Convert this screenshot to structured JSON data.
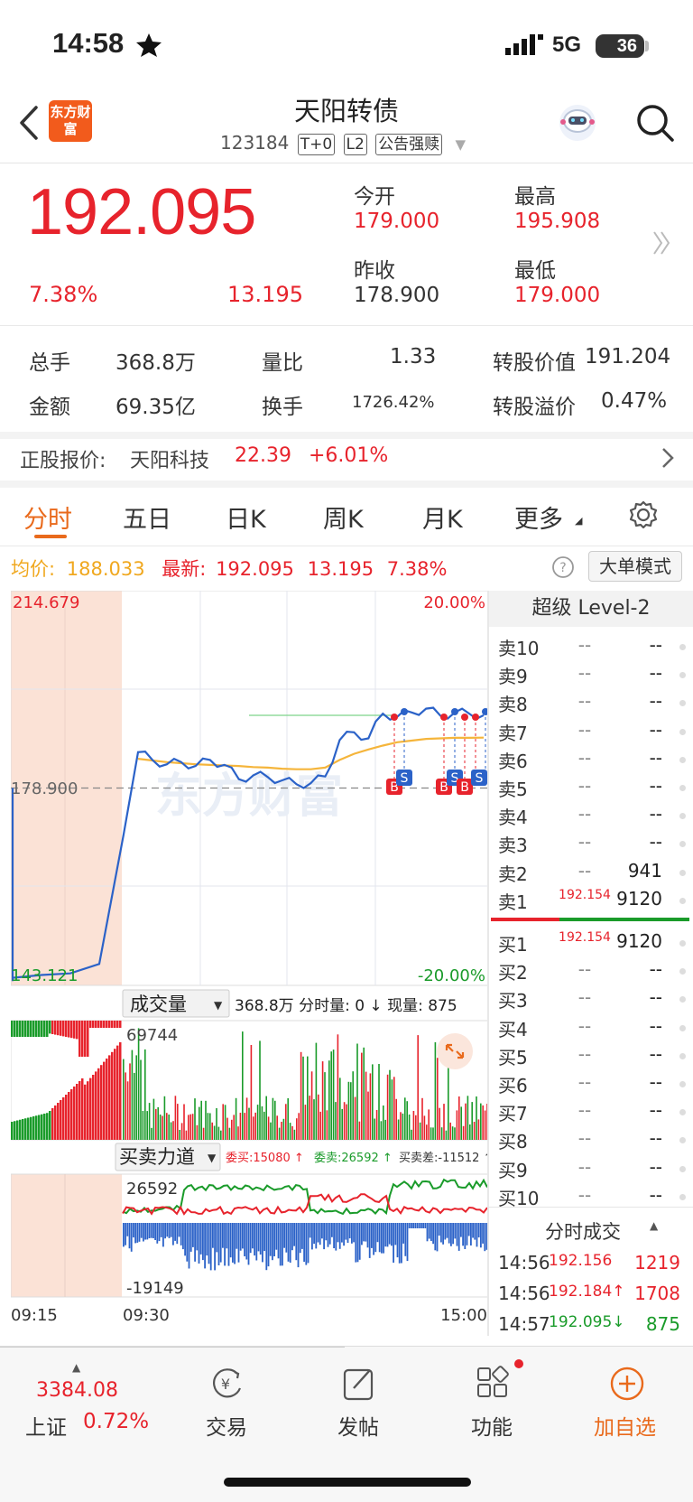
{
  "status": {
    "time": "14:58",
    "network": "5G",
    "battery": "36"
  },
  "header": {
    "logo_text": "东方财富",
    "title": "天阳转债",
    "code": "123184",
    "tags": [
      "T+0",
      "L2",
      "公告强赎"
    ]
  },
  "quote": {
    "price": "192.095",
    "change_pct": "7.38%",
    "change": "13.195",
    "open_label": "今开",
    "open": "179.000",
    "high_label": "最高",
    "high": "195.908",
    "prev_close_label": "昨收",
    "prev_close": "178.900",
    "low_label": "最低",
    "low": "179.000"
  },
  "stats": {
    "volume_label": "总手",
    "volume": "368.8万",
    "ratio_label": "量比",
    "ratio": "1.33",
    "conv_value_label": "转股价值",
    "conv_value": "191.204",
    "amount_label": "金额",
    "amount": "69.35亿",
    "turnover_label": "换手",
    "turnover": "1726.42%",
    "premium_label": "转股溢价",
    "premium": "0.47%"
  },
  "underlying": {
    "label": "正股报价:",
    "name": "天阳科技",
    "price": "22.39",
    "change": "+6.01%"
  },
  "tabs": [
    "分时",
    "五日",
    "日K",
    "周K",
    "月K",
    "更多"
  ],
  "avg_row": {
    "avg_label": "均价:",
    "avg": "188.033",
    "latest_label": "最新:",
    "latest": "192.095",
    "latest_chg": "13.195",
    "latest_pct": "7.38%",
    "mode_button": "大单模式"
  },
  "chart": {
    "top_price": "214.679",
    "top_pct": "20.00%",
    "mid_price": "178.900",
    "bottom_price": "143.121",
    "bottom_pct": "-20.00%",
    "volume_selector": "成交量",
    "volume_info": "368.8万 分时量: 0 ↓ 现量: 875",
    "volume_max": "69744",
    "force_selector": "买卖力道",
    "force_buy": "委买:15080 ↑",
    "force_sell": "委卖:26592 ↑",
    "force_diff": "买卖差:-11512 ↑",
    "force_max": "26592",
    "force_min": "-19149",
    "time_labels": [
      "09:15",
      "09:30",
      "15:00"
    ],
    "watermark": "东方财富",
    "marker_letters": [
      "B",
      "S"
    ],
    "colors": {
      "up": "#e7232c",
      "down": "#1a9b2a",
      "price_line": "#2b62c8",
      "avg_line": "#f5b53b",
      "auction_bg": "#fbe2d6"
    }
  },
  "chart_data": {
    "type": "line",
    "x_range": [
      "09:15",
      "15:00"
    ],
    "ylim": [
      143.121,
      214.679
    ],
    "base": 178.9,
    "series": [
      {
        "name": "最新",
        "values": [
          144.5,
          145.0,
          145.3,
          147.0,
          170.5,
          185.4,
          184.0,
          183.2,
          183.6,
          182.9,
          184.0,
          183.1,
          180.5,
          181.2,
          180.9,
          180.3,
          179.6,
          179.8,
          181.0,
          187.6,
          189.0,
          187.9,
          192.4,
          191.8,
          192.6,
          193.3,
          192.0,
          192.6,
          192.4,
          192.095
        ]
      },
      {
        "name": "均价",
        "values": [
          null,
          null,
          null,
          null,
          null,
          184.2,
          183.9,
          183.6,
          183.4,
          183.2,
          183.1,
          183.0,
          182.9,
          182.7,
          182.6,
          182.4,
          182.3,
          182.3,
          182.6,
          184.0,
          185.1,
          185.9,
          186.6,
          187.2,
          187.5,
          187.8,
          187.9,
          188.0,
          188.0,
          188.033
        ]
      }
    ]
  },
  "orderbook": {
    "title": "超级 Level-2",
    "asks": [
      {
        "label": "卖10",
        "price": "--",
        "vol": "--"
      },
      {
        "label": "卖9",
        "price": "--",
        "vol": "--"
      },
      {
        "label": "卖8",
        "price": "--",
        "vol": "--"
      },
      {
        "label": "卖7",
        "price": "--",
        "vol": "--"
      },
      {
        "label": "卖6",
        "price": "--",
        "vol": "--"
      },
      {
        "label": "卖5",
        "price": "--",
        "vol": "--"
      },
      {
        "label": "卖4",
        "price": "--",
        "vol": "--"
      },
      {
        "label": "卖3",
        "price": "--",
        "vol": "--"
      },
      {
        "label": "卖2",
        "price": "--",
        "vol": "941"
      },
      {
        "label": "卖1",
        "price": "192.154",
        "vol": "9120"
      }
    ],
    "bids": [
      {
        "label": "买1",
        "price": "192.154",
        "vol": "9120"
      },
      {
        "label": "买2",
        "price": "--",
        "vol": "--"
      },
      {
        "label": "买3",
        "price": "--",
        "vol": "--"
      },
      {
        "label": "买4",
        "price": "--",
        "vol": "--"
      },
      {
        "label": "买5",
        "price": "--",
        "vol": "--"
      },
      {
        "label": "买6",
        "price": "--",
        "vol": "--"
      },
      {
        "label": "买7",
        "price": "--",
        "vol": "--"
      },
      {
        "label": "买8",
        "price": "--",
        "vol": "--"
      },
      {
        "label": "买9",
        "price": "--",
        "vol": "--"
      },
      {
        "label": "买10",
        "price": "--",
        "vol": "--"
      }
    ],
    "trades_title": "分时成交",
    "trades": [
      {
        "time": "14:56",
        "price": "192.156",
        "vol": "1219"
      },
      {
        "time": "14:56",
        "price": "192.184↑",
        "vol": "1708"
      },
      {
        "time": "14:57",
        "price": "192.095↓",
        "vol": "875"
      }
    ]
  },
  "bottom": {
    "index_value": "3384.08",
    "index_name": "上证",
    "index_pct": "0.72%",
    "nav": [
      "交易",
      "发帖",
      "功能",
      "加自选"
    ]
  }
}
